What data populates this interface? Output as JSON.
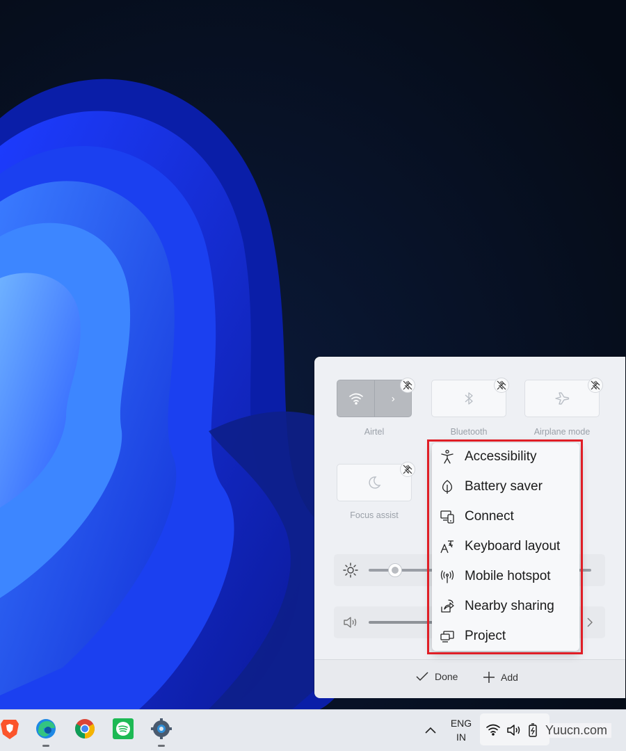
{
  "quick_settings": {
    "tiles": [
      {
        "label": "Airtel",
        "icon": "wifi-icon",
        "state": "on"
      },
      {
        "label": "Bluetooth",
        "icon": "bluetooth-icon",
        "state": "off"
      },
      {
        "label": "Airplane mode",
        "icon": "airplane-icon",
        "state": "off"
      },
      {
        "label": "Focus assist",
        "icon": "moon-icon",
        "state": "off"
      }
    ],
    "brightness_level": 0.12,
    "volume_level": 0.22,
    "done_label": "Done",
    "add_label": "Add"
  },
  "add_menu": {
    "items": [
      {
        "label": "Accessibility",
        "icon": "accessibility-icon"
      },
      {
        "label": "Battery saver",
        "icon": "battery-saver-leaf-icon"
      },
      {
        "label": "Connect",
        "icon": "connect-icon"
      },
      {
        "label": "Keyboard layout",
        "icon": "keyboard-layout-icon"
      },
      {
        "label": "Mobile hotspot",
        "icon": "mobile-hotspot-icon"
      },
      {
        "label": "Nearby sharing",
        "icon": "nearby-sharing-icon"
      },
      {
        "label": "Project",
        "icon": "project-icon"
      }
    ],
    "highlight_color": "#e01e26"
  },
  "taskbar": {
    "apps": [
      {
        "name": "Brave",
        "icon": "brave-icon"
      },
      {
        "name": "Microsoft Edge",
        "icon": "edge-icon"
      },
      {
        "name": "Google Chrome",
        "icon": "chrome-icon"
      },
      {
        "name": "Spotify",
        "icon": "spotify-icon"
      },
      {
        "name": "Settings",
        "icon": "settings-gear-icon"
      }
    ],
    "language_line1": "ENG",
    "language_line2": "IN"
  },
  "watermark": "Yuucn.com"
}
